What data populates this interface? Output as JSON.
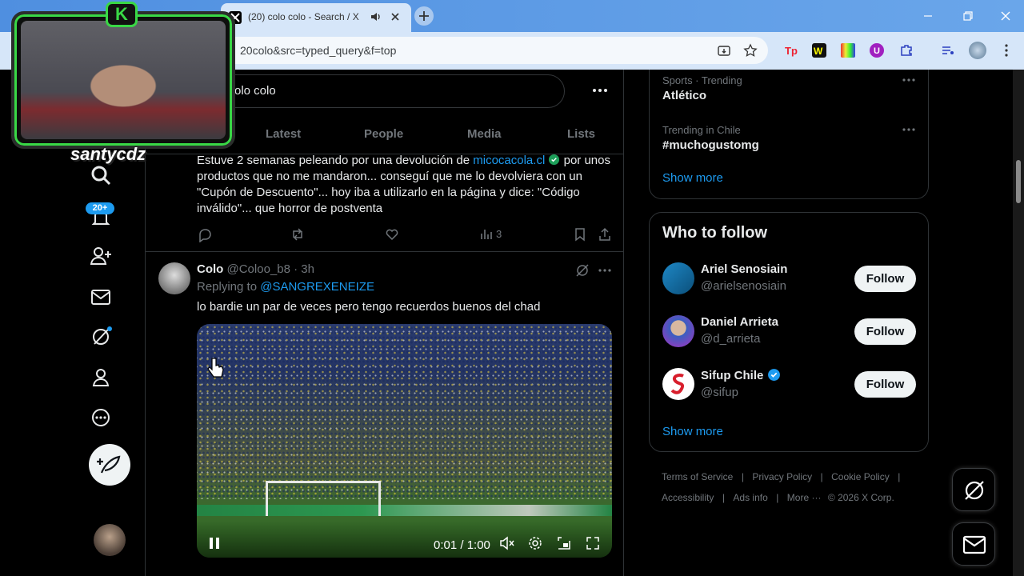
{
  "browser": {
    "tab_title": "(20) colo colo - Search / X",
    "url": "20colo&src=typed_query&f=top"
  },
  "streamer": {
    "name": "santycdz",
    "badge_letter": "K"
  },
  "nav": {
    "notifications_badge": "20+"
  },
  "search": {
    "query": "olo colo",
    "tabs": [
      "Latest",
      "People",
      "Media",
      "Lists"
    ]
  },
  "post1": {
    "text_before": "Estuve 2 semanas peleando por una devolución de ",
    "link": "micocacola.cl",
    "text_after": " por unos productos que no me mandaron... conseguí que me lo devolviera con un \"Cupón de Descuento\"... hoy iba a utilizarlo en la página y dice: \"Código inválido\"... que horror de postventa",
    "views": "3"
  },
  "post2": {
    "author": "Colo",
    "handle": "@Coloo_b8",
    "time": "· 3h",
    "replying_label": "Replying to ",
    "replying_to": "@SANGREXENEIZE",
    "text": "lo bardie un par de veces pero tengo recuerdos buenos del chad",
    "video_time": "0:01 / 1:00"
  },
  "trends": [
    {
      "context": "Sports · Trending",
      "name": "Atlético"
    },
    {
      "context": "Trending in Chile",
      "name": "#muchogustomg"
    }
  ],
  "trends_show_more": "Show more",
  "who_to_follow": {
    "title": "Who to follow",
    "users": [
      {
        "name": "Ariel Senosiain",
        "handle": "@arielsenosiain",
        "button": "Follow"
      },
      {
        "name": "Daniel Arrieta",
        "handle": "@d_arrieta",
        "button": "Follow"
      },
      {
        "name": "Sifup Chile",
        "handle": "@sifup",
        "button": "Follow"
      }
    ],
    "show_more": "Show more"
  },
  "footer": {
    "links": [
      "Terms of Service",
      "Privacy Policy",
      "Cookie Policy",
      "Accessibility",
      "Ads info",
      "More ···"
    ],
    "copyright": "© 2026 X Corp."
  },
  "colors": {
    "accent": "#1d9bf0",
    "verified": "#1d9bf0",
    "overlay_green": "#39d846"
  }
}
